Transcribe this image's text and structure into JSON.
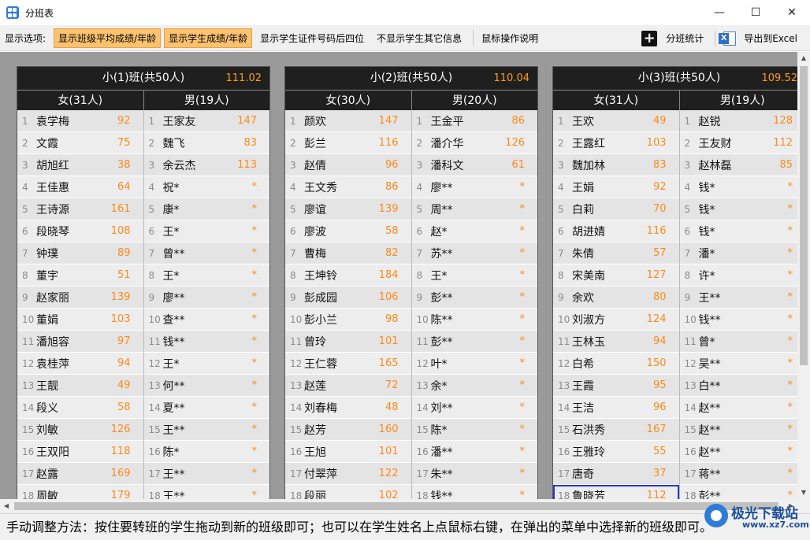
{
  "window": {
    "title": "分班表"
  },
  "toolbar": {
    "label": "显示选项:",
    "btn_avg": "显示班级平均成绩/年龄",
    "btn_student": "显示学生成绩/年龄",
    "btn_id": "显示学生证件号码后四位",
    "btn_hide": "不显示学生其它信息",
    "btn_help": "鼠标操作说明",
    "btn_stats": "分班统计",
    "btn_excel": "导出到Excel"
  },
  "status": "手动调整方法：按住要转班的学生拖动到新的班级即可；也可以在学生姓名上点鼠标右键，在弹出的菜单中选择新的班级即可。",
  "watermark": {
    "text": "极光下载站",
    "sub": "www.xz7.com"
  },
  "classes": [
    {
      "title": "小(1)班(共50人)",
      "avg": "111.02",
      "female_header": "女(31人)",
      "male_header": "男(19人)",
      "female": [
        {
          "no": "1",
          "name": "袁学梅",
          "score": "92"
        },
        {
          "no": "2",
          "name": "文霞",
          "score": "75"
        },
        {
          "no": "3",
          "name": "胡旭红",
          "score": "38"
        },
        {
          "no": "4",
          "name": "王佳惠",
          "score": "64"
        },
        {
          "no": "5",
          "name": "王诗源",
          "score": "161"
        },
        {
          "no": "6",
          "name": "段晓琴",
          "score": "108"
        },
        {
          "no": "7",
          "name": "钟璞",
          "score": "89"
        },
        {
          "no": "8",
          "name": "董宇",
          "score": "51"
        },
        {
          "no": "9",
          "name": "赵家丽",
          "score": "139"
        },
        {
          "no": "10",
          "name": "董娟",
          "score": "103"
        },
        {
          "no": "11",
          "name": "潘旭容",
          "score": "97"
        },
        {
          "no": "12",
          "name": "袁桂萍",
          "score": "94"
        },
        {
          "no": "13",
          "name": "王靓",
          "score": "49"
        },
        {
          "no": "14",
          "name": "段义",
          "score": "58"
        },
        {
          "no": "15",
          "name": "刘敏",
          "score": "126"
        },
        {
          "no": "16",
          "name": "王双阳",
          "score": "118"
        },
        {
          "no": "17",
          "name": "赵露",
          "score": "169"
        },
        {
          "no": "18",
          "name": "周敏",
          "score": "179"
        }
      ],
      "male": [
        {
          "no": "1",
          "name": "王家友",
          "score": "147"
        },
        {
          "no": "2",
          "name": "魏飞",
          "score": "83"
        },
        {
          "no": "3",
          "name": "余云杰",
          "score": "113"
        },
        {
          "no": "4",
          "name": "祝*",
          "score": "*"
        },
        {
          "no": "5",
          "name": "康*",
          "score": "*"
        },
        {
          "no": "6",
          "name": "王*",
          "score": "*"
        },
        {
          "no": "7",
          "name": "曾**",
          "score": "*"
        },
        {
          "no": "8",
          "name": "王*",
          "score": "*"
        },
        {
          "no": "9",
          "name": "廖**",
          "score": "*"
        },
        {
          "no": "10",
          "name": "查**",
          "score": "*"
        },
        {
          "no": "11",
          "name": "钱**",
          "score": "*"
        },
        {
          "no": "12",
          "name": "王*",
          "score": "*"
        },
        {
          "no": "13",
          "name": "何**",
          "score": "*"
        },
        {
          "no": "14",
          "name": "夏**",
          "score": "*"
        },
        {
          "no": "15",
          "name": "王**",
          "score": "*"
        },
        {
          "no": "16",
          "name": "陈*",
          "score": "*"
        },
        {
          "no": "17",
          "name": "王**",
          "score": "*"
        },
        {
          "no": "18",
          "name": "王**",
          "score": "*"
        }
      ]
    },
    {
      "title": "小(2)班(共50人)",
      "avg": "110.04",
      "female_header": "女(30人)",
      "male_header": "男(20人)",
      "female": [
        {
          "no": "1",
          "name": "颜欢",
          "score": "147"
        },
        {
          "no": "2",
          "name": "彭兰",
          "score": "116"
        },
        {
          "no": "3",
          "name": "赵倩",
          "score": "96"
        },
        {
          "no": "4",
          "name": "王文秀",
          "score": "86"
        },
        {
          "no": "5",
          "name": "廖谊",
          "score": "139"
        },
        {
          "no": "6",
          "name": "廖波",
          "score": "58"
        },
        {
          "no": "7",
          "name": "曹梅",
          "score": "82"
        },
        {
          "no": "8",
          "name": "王坤铃",
          "score": "184"
        },
        {
          "no": "9",
          "name": "彭成园",
          "score": "106"
        },
        {
          "no": "10",
          "name": "彭小兰",
          "score": "98"
        },
        {
          "no": "11",
          "name": "曾玲",
          "score": "101"
        },
        {
          "no": "12",
          "name": "王仁蓉",
          "score": "165"
        },
        {
          "no": "13",
          "name": "赵莲",
          "score": "72"
        },
        {
          "no": "14",
          "name": "刘春梅",
          "score": "48"
        },
        {
          "no": "15",
          "name": "赵芳",
          "score": "160"
        },
        {
          "no": "16",
          "name": "王旭",
          "score": "101"
        },
        {
          "no": "17",
          "name": "付翠萍",
          "score": "122"
        },
        {
          "no": "18",
          "name": "段丽",
          "score": "102"
        }
      ],
      "male": [
        {
          "no": "1",
          "name": "王金平",
          "score": "86"
        },
        {
          "no": "2",
          "name": "潘介华",
          "score": "126"
        },
        {
          "no": "3",
          "name": "潘科文",
          "score": "61"
        },
        {
          "no": "4",
          "name": "廖**",
          "score": "*"
        },
        {
          "no": "5",
          "name": "周**",
          "score": "*"
        },
        {
          "no": "6",
          "name": "赵*",
          "score": "*"
        },
        {
          "no": "7",
          "name": "苏**",
          "score": "*"
        },
        {
          "no": "8",
          "name": "王*",
          "score": "*"
        },
        {
          "no": "9",
          "name": "彭**",
          "score": "*"
        },
        {
          "no": "10",
          "name": "陈**",
          "score": "*"
        },
        {
          "no": "11",
          "name": "彭**",
          "score": "*"
        },
        {
          "no": "12",
          "name": "叶*",
          "score": "*"
        },
        {
          "no": "13",
          "name": "余*",
          "score": "*"
        },
        {
          "no": "14",
          "name": "刘**",
          "score": "*"
        },
        {
          "no": "15",
          "name": "陈*",
          "score": "*"
        },
        {
          "no": "16",
          "name": "潘**",
          "score": "*"
        },
        {
          "no": "17",
          "name": "朱**",
          "score": "*"
        },
        {
          "no": "18",
          "name": "钱**",
          "score": "*"
        }
      ]
    },
    {
      "title": "小(3)班(共50人)",
      "avg": "109.52",
      "female_header": "女(31人)",
      "male_header": "男(19人)",
      "female": [
        {
          "no": "1",
          "name": "王欢",
          "score": "49"
        },
        {
          "no": "2",
          "name": "王露红",
          "score": "103"
        },
        {
          "no": "3",
          "name": "魏加林",
          "score": "83"
        },
        {
          "no": "4",
          "name": "王娟",
          "score": "92"
        },
        {
          "no": "5",
          "name": "白莉",
          "score": "70"
        },
        {
          "no": "6",
          "name": "胡进婧",
          "score": "116"
        },
        {
          "no": "7",
          "name": "朱倩",
          "score": "57"
        },
        {
          "no": "8",
          "name": "宋美南",
          "score": "127"
        },
        {
          "no": "9",
          "name": "余欢",
          "score": "80"
        },
        {
          "no": "10",
          "name": "刘淑方",
          "score": "124"
        },
        {
          "no": "11",
          "name": "王林玉",
          "score": "94"
        },
        {
          "no": "12",
          "name": "白希",
          "score": "150"
        },
        {
          "no": "13",
          "name": "王霞",
          "score": "95"
        },
        {
          "no": "14",
          "name": "王洁",
          "score": "96"
        },
        {
          "no": "15",
          "name": "石洪秀",
          "score": "167"
        },
        {
          "no": "16",
          "name": "王雅玲",
          "score": "55"
        },
        {
          "no": "17",
          "name": "唐奇",
          "score": "37"
        },
        {
          "no": "18",
          "name": "鲁晓芳",
          "score": "112"
        }
      ],
      "male": [
        {
          "no": "1",
          "name": "赵锐",
          "score": "128"
        },
        {
          "no": "2",
          "name": "王友财",
          "score": "112"
        },
        {
          "no": "3",
          "name": "赵林磊",
          "score": "85"
        },
        {
          "no": "4",
          "name": "钱*",
          "score": "*"
        },
        {
          "no": "5",
          "name": "钱*",
          "score": "*"
        },
        {
          "no": "6",
          "name": "钱*",
          "score": "*"
        },
        {
          "no": "7",
          "name": "潘*",
          "score": "*"
        },
        {
          "no": "8",
          "name": "许*",
          "score": "*"
        },
        {
          "no": "9",
          "name": "王**",
          "score": "*"
        },
        {
          "no": "10",
          "name": "钱**",
          "score": "*"
        },
        {
          "no": "11",
          "name": "曾*",
          "score": "*"
        },
        {
          "no": "12",
          "name": "吴**",
          "score": "*"
        },
        {
          "no": "13",
          "name": "白**",
          "score": "*"
        },
        {
          "no": "14",
          "name": "赵**",
          "score": "*"
        },
        {
          "no": "15",
          "name": "赵**",
          "score": "*"
        },
        {
          "no": "16",
          "name": "赵**",
          "score": "*"
        },
        {
          "no": "17",
          "name": "蒋**",
          "score": "*"
        },
        {
          "no": "18",
          "name": "彭**",
          "score": "*"
        }
      ]
    }
  ]
}
